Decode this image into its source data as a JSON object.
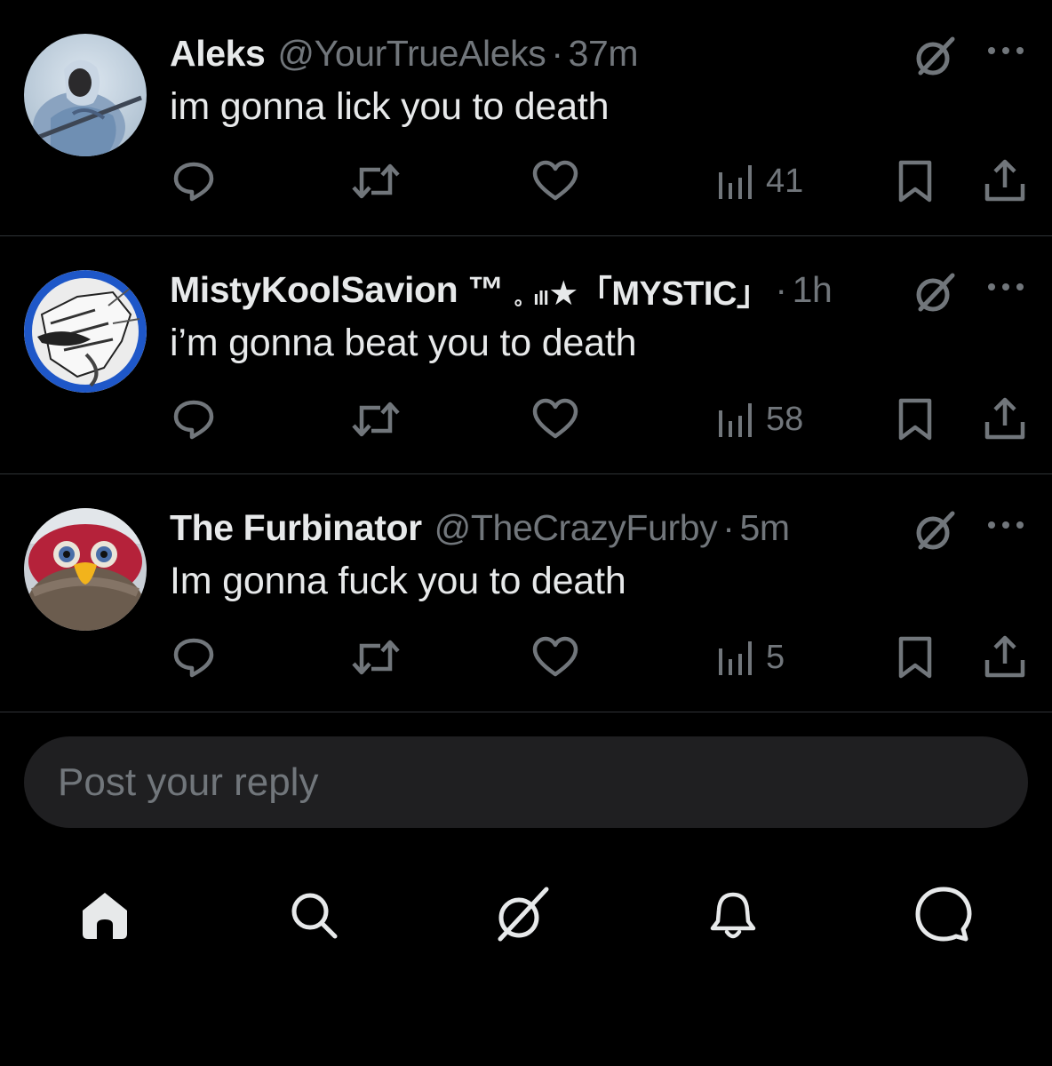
{
  "posts": [
    {
      "display_name": "Aleks",
      "handle": "@YourTrueAleks",
      "separator": "·",
      "time": "37m",
      "badge": "",
      "text": "im gonna lick you to death",
      "views": "41",
      "avatar": "avatar-aleks"
    },
    {
      "display_name": "MistyKoolSavion ™",
      "handle": "",
      "separator": "·",
      "time": "1h",
      "badge_prefix": "。ıll",
      "badge": "★「MYSTIC」",
      "text": "i’m gonna beat you to death",
      "views": "58",
      "avatar": "avatar-misty"
    },
    {
      "display_name": "The Furbinator",
      "handle": "@TheCrazyFurby",
      "separator": "·",
      "time": "5m",
      "badge": "",
      "text": "Im gonna fuck you to death",
      "views": "5",
      "avatar": "avatar-furby"
    }
  ],
  "icons": {
    "grok": "grok-icon",
    "more": "more-icon",
    "reply": "reply-icon",
    "repost": "repost-icon",
    "like": "heart-icon",
    "views": "views-icon",
    "bookmark": "bookmark-icon",
    "share": "share-icon"
  },
  "reply_bar": {
    "placeholder": "Post your reply"
  },
  "tabbar": {
    "items": [
      "home-icon",
      "search-icon",
      "grok-icon",
      "bell-icon",
      "messages-icon"
    ]
  },
  "colors": {
    "background": "#000000",
    "text_primary": "#e7e9ea",
    "text_secondary": "#71767b",
    "divider": "#2f3336",
    "reply_bar": "#1f1f21"
  }
}
